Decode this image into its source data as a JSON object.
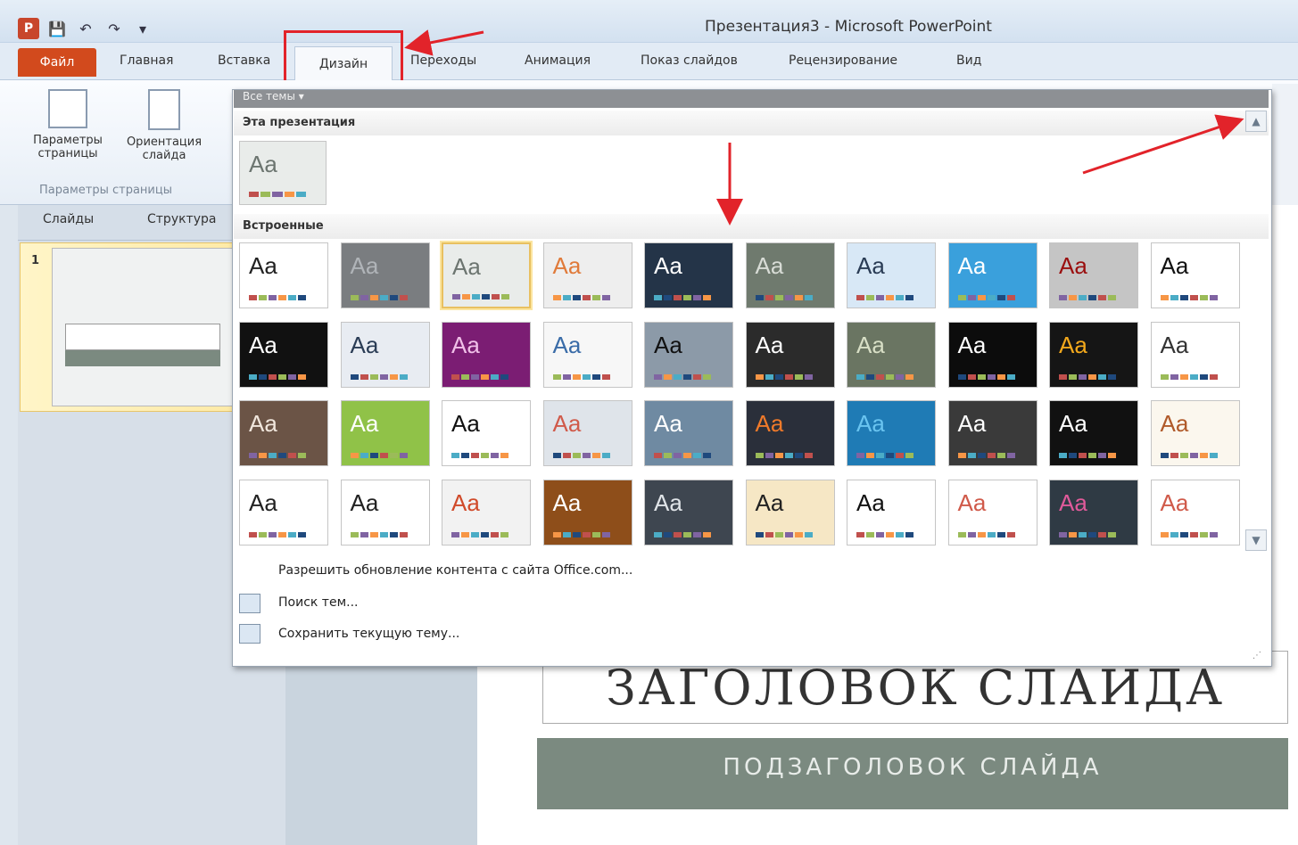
{
  "window": {
    "title": "Презентация3 - Microsoft PowerPoint"
  },
  "qat": {
    "app_icon": "powerpoint-icon",
    "items": [
      "save-icon",
      "undo-icon",
      "redo-icon",
      "customize-icon"
    ]
  },
  "ribbon_tabs": [
    {
      "label": "Файл"
    },
    {
      "label": "Главная"
    },
    {
      "label": "Вставка"
    },
    {
      "label": "Дизайн"
    },
    {
      "label": "Переходы"
    },
    {
      "label": "Анимация"
    },
    {
      "label": "Показ слайдов"
    },
    {
      "label": "Рецензирование"
    },
    {
      "label": "Вид"
    }
  ],
  "ribbon": {
    "page_setup_label": "Параметры страницы",
    "orientation_label": "Ориентация слайда",
    "group_label": "Параметры страницы"
  },
  "left_pane": {
    "tab_slides": "Слайды",
    "tab_outline": "Структура",
    "slide_number": "1"
  },
  "gallery": {
    "header": "Все темы",
    "section_current": "Эта презентация",
    "section_builtin": "Встроенные",
    "current_theme_label": "Aa",
    "themes": [
      {
        "label": "Aa",
        "bg": "#ffffff",
        "fg": "#222222"
      },
      {
        "label": "Aa",
        "bg": "#7a7d80",
        "fg": "#b0b4b8"
      },
      {
        "label": "Aa",
        "bg": "#e9ecea",
        "fg": "#6c7570"
      },
      {
        "label": "Aa",
        "bg": "#eeeeee",
        "fg": "#e07a3a"
      },
      {
        "label": "Aa",
        "bg": "#243448",
        "fg": "#ffffff"
      },
      {
        "label": "Aa",
        "bg": "#6f7a6e",
        "fg": "#d8dcd6"
      },
      {
        "label": "Aa",
        "bg": "#d8e8f6",
        "fg": "#2a3c55"
      },
      {
        "label": "Aa",
        "bg": "#3aa0dc",
        "fg": "#ffffff"
      },
      {
        "label": "Aa",
        "bg": "#c5c5c5",
        "fg": "#9a0f0f"
      },
      {
        "label": "Aa",
        "bg": "#ffffff",
        "fg": "#111111"
      },
      {
        "label": "Aa",
        "bg": "#111111",
        "fg": "#ffffff"
      },
      {
        "label": "Aa",
        "bg": "#e8ecf2",
        "fg": "#2a3c55"
      },
      {
        "label": "Aa",
        "bg": "#7b1d73",
        "fg": "#f0c0e8"
      },
      {
        "label": "Aa",
        "bg": "#f7f7f7",
        "fg": "#3a6ca8"
      },
      {
        "label": "Aa",
        "bg": "#8c9aa8",
        "fg": "#111111"
      },
      {
        "label": "Aa",
        "bg": "#2b2b2b",
        "fg": "#ffffff"
      },
      {
        "label": "Aa",
        "bg": "#6a7562",
        "fg": "#d8dfc6"
      },
      {
        "label": "Aa",
        "bg": "#0c0c0c",
        "fg": "#ffffff"
      },
      {
        "label": "Aa",
        "bg": "#151515",
        "fg": "#f2a81c"
      },
      {
        "label": "Aa",
        "bg": "#ffffff",
        "fg": "#333333"
      },
      {
        "label": "Aa",
        "bg": "#6b5446",
        "fg": "#f0e6dc"
      },
      {
        "label": "Aa",
        "bg": "#90c248",
        "fg": "#ffffff"
      },
      {
        "label": "Aa",
        "bg": "#ffffff",
        "fg": "#111111"
      },
      {
        "label": "Aa",
        "bg": "#dfe4ea",
        "fg": "#d05a4a"
      },
      {
        "label": "Aa",
        "bg": "#6f8aa2",
        "fg": "#ffffff"
      },
      {
        "label": "Aa",
        "bg": "#2a2f3a",
        "fg": "#f07a2a"
      },
      {
        "label": "Aa",
        "bg": "#1f7bb5",
        "fg": "#6ac4f0"
      },
      {
        "label": "Aa",
        "bg": "#3a3a3a",
        "fg": "#ffffff"
      },
      {
        "label": "Aa",
        "bg": "#111111",
        "fg": "#ffffff"
      },
      {
        "label": "Aa",
        "bg": "#fbf7ee",
        "fg": "#b05a2a"
      },
      {
        "label": "Aa",
        "bg": "#ffffff",
        "fg": "#222222"
      },
      {
        "label": "Aa",
        "bg": "#ffffff",
        "fg": "#222222"
      },
      {
        "label": "Aa",
        "bg": "#f2f2f2",
        "fg": "#d04a2a"
      },
      {
        "label": "Aa",
        "bg": "#8e4e1a",
        "fg": "#ffffff"
      },
      {
        "label": "Aa",
        "bg": "#3e4650",
        "fg": "#e0e4e8"
      },
      {
        "label": "Aa",
        "bg": "#f6e7c5",
        "fg": "#222222"
      },
      {
        "label": "Aa",
        "bg": "#ffffff",
        "fg": "#111111"
      },
      {
        "label": "Aa",
        "bg": "#ffffff",
        "fg": "#d05a4a"
      },
      {
        "label": "Aa",
        "bg": "#2f3a44",
        "fg": "#e05a9a"
      },
      {
        "label": "Aa",
        "bg": "#ffffff",
        "fg": "#d05a4a"
      }
    ],
    "menu": [
      {
        "label": "Разрешить обновление контента с сайта Office.com...",
        "icon": ""
      },
      {
        "label": "Поиск тем...",
        "icon": "folder-search-icon"
      },
      {
        "label": "Сохранить текущую тему...",
        "icon": "save-theme-icon"
      }
    ]
  },
  "slide": {
    "title": "ЗАГОЛОВОК СЛАЙДА",
    "subtitle": "ПОДЗАГОЛОВОК СЛАЙДА"
  },
  "annotations": {
    "color": "#e2232a"
  }
}
